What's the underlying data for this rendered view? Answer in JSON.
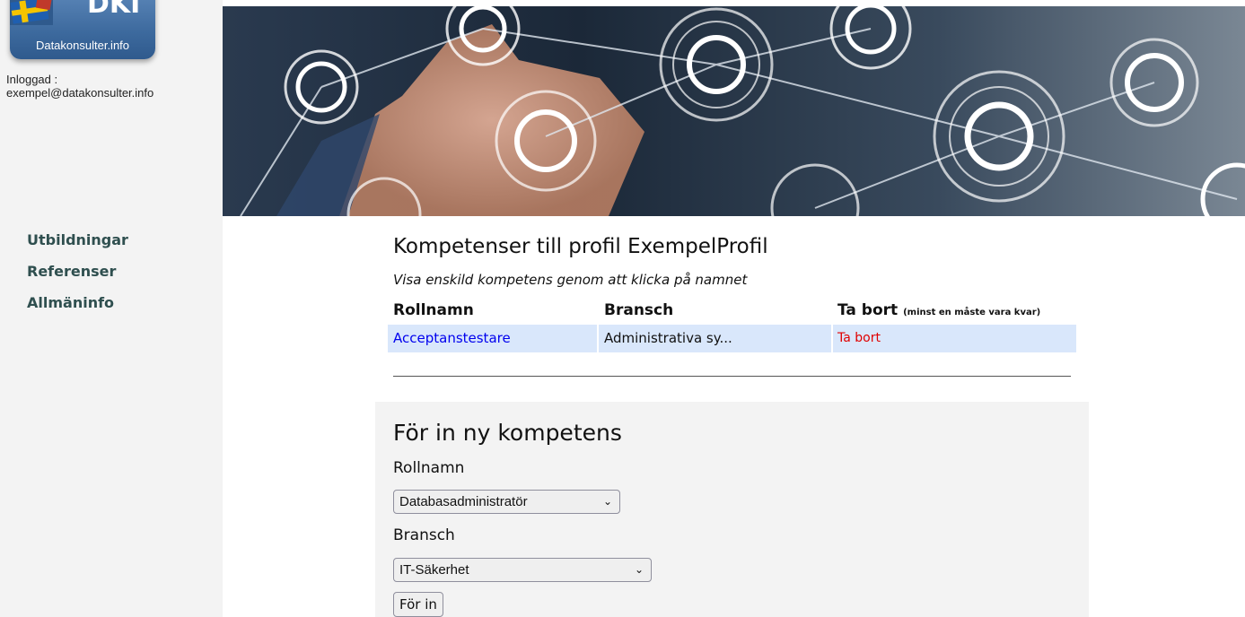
{
  "logo": {
    "mark": "DKI",
    "brand": "Datakonsulter.info"
  },
  "login": {
    "label": "Inloggad :",
    "email": "exempel@datakonsulter.info"
  },
  "nav": [
    {
      "label": "Utbildningar"
    },
    {
      "label": "Referenser"
    },
    {
      "label": "Allmäninfo"
    }
  ],
  "main": {
    "title": "Kompetenser till profil ExempelProfil",
    "subtitle": "Visa enskild kompetens genom att klicka på namnet",
    "columns": {
      "role": "Rollnamn",
      "industry": "Bransch",
      "remove": "Ta bort",
      "remove_note": "(minst en måste vara kvar)"
    },
    "rows": [
      {
        "role": "Acceptanstestare",
        "industry": "Administrativa sy...",
        "remove": "Ta bort"
      }
    ]
  },
  "form": {
    "heading": "För in ny kompetens",
    "role_label": "Rollnamn",
    "role_selected": "Databasadministratör",
    "industry_label": "Bransch",
    "industry_selected": "IT-Säkerhet",
    "submit_label": "För in"
  },
  "colors": {
    "link": "#0000ee",
    "delete": "#e00000",
    "row_bg": "#d9e7fb",
    "nav": "#2f4f4f"
  }
}
